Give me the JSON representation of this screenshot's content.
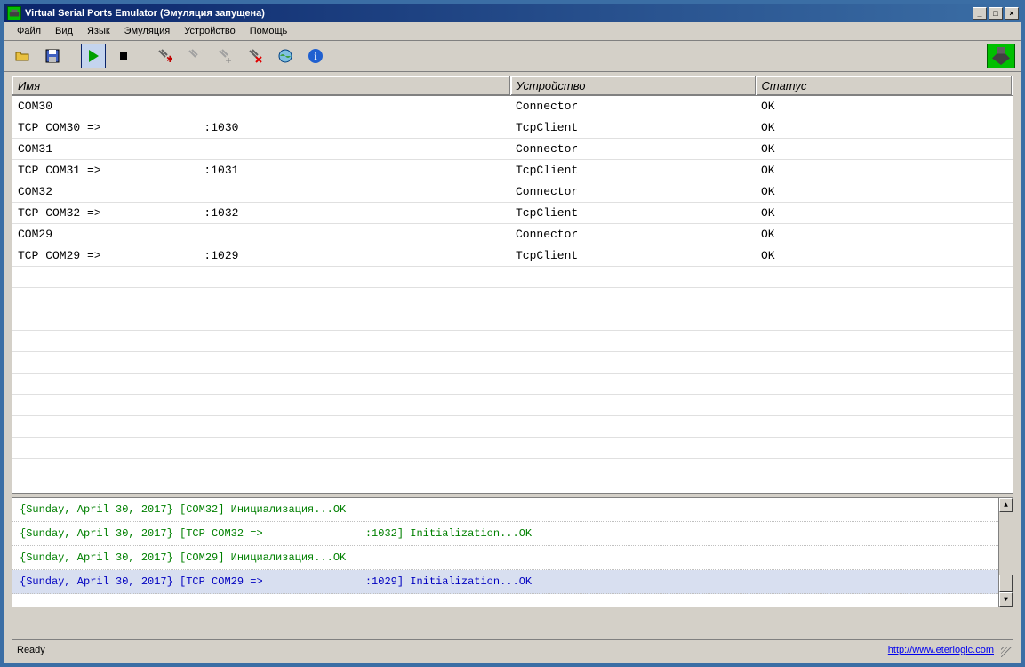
{
  "title": "Virtual Serial Ports Emulator (Эмуляция запущена)",
  "menu": {
    "file": "Файл",
    "view": "Вид",
    "lang": "Язык",
    "emul": "Эмуляция",
    "device": "Устройство",
    "help": "Помощь"
  },
  "table": {
    "headers": {
      "name": "Имя",
      "device": "Устройство",
      "status": "Статус"
    },
    "rows": [
      {
        "name_pre": "COM30",
        "redacted": false,
        "name_post": "",
        "device": "Connector",
        "status": "OK"
      },
      {
        "name_pre": "TCP COM30 => ",
        "redacted": true,
        "name_post": ":1030",
        "device": "TcpClient",
        "status": "OK"
      },
      {
        "name_pre": "COM31",
        "redacted": false,
        "name_post": "",
        "device": "Connector",
        "status": "OK"
      },
      {
        "name_pre": "TCP COM31 => ",
        "redacted": true,
        "name_post": ":1031",
        "device": "TcpClient",
        "status": "OK"
      },
      {
        "name_pre": "COM32",
        "redacted": false,
        "name_post": "",
        "device": "Connector",
        "status": "OK"
      },
      {
        "name_pre": "TCP COM32 => ",
        "redacted": true,
        "name_post": ":1032",
        "device": "TcpClient",
        "status": "OK"
      },
      {
        "name_pre": "COM29",
        "redacted": false,
        "name_post": "",
        "device": "Connector",
        "status": "OK"
      },
      {
        "name_pre": "TCP COM29 => ",
        "redacted": true,
        "name_post": ":1029",
        "device": "TcpClient",
        "status": "OK"
      }
    ],
    "empty_rows": 9
  },
  "log": [
    {
      "pre": "{Sunday, April 30, 2017} [COM32] Инициализация...OK",
      "redacted": false,
      "post": "",
      "sel": false
    },
    {
      "pre": "{Sunday, April 30, 2017} [TCP COM32 => ",
      "redacted": true,
      "post": ":1032] Initialization...OK",
      "sel": false
    },
    {
      "pre": "{Sunday, April 30, 2017} [COM29] Инициализация...OK",
      "redacted": false,
      "post": "",
      "sel": false
    },
    {
      "pre": "{Sunday, April 30, 2017} [TCP COM29 => ",
      "redacted": true,
      "post": ":1029] Initialization...OK",
      "sel": true
    }
  ],
  "status": {
    "text": "Ready",
    "link": "http://www.eterlogic.com"
  }
}
